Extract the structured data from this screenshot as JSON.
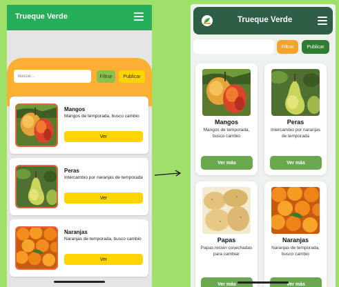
{
  "left_app": {
    "title": "Trueque Verde",
    "search_placeholder": "Buscar...",
    "filter_label": "Filtrar",
    "publish_label": "Publicar",
    "items": [
      {
        "name": "Mangos",
        "description": "Mangos de temporada, busco cambio",
        "button": "Ver",
        "image": "mango-photo"
      },
      {
        "name": "Peras",
        "description": "Intercambio por naranjas de temporada",
        "button": "Ver",
        "image": "pear-photo"
      },
      {
        "name": "Naranjas",
        "description": "Naranjas de temporada, busco cambio",
        "button": "Ver",
        "image": "orange-photo"
      }
    ]
  },
  "right_app": {
    "title": "Trueque Verde",
    "search_placeholder": "",
    "filter_label": "Filtrar",
    "publish_label": "Publicar",
    "items": [
      {
        "name": "Mangos",
        "description": "Mangos de temporada, busco cambio",
        "button": "Ver más",
        "image": "mango-photo"
      },
      {
        "name": "Peras",
        "description": "Intercambio por naranjas de temporada",
        "button": "Ver más",
        "image": "pear-photo"
      },
      {
        "name": "Papas",
        "description": "Papas recién cosechadas para cambiar",
        "button": "Ver más",
        "image": "potato-photo"
      },
      {
        "name": "Naranjas",
        "description": "Naranjas de temporada, busco cambio",
        "button": "Ver más",
        "image": "orange-photo"
      }
    ]
  },
  "colors": {
    "background": "#9ee06a",
    "left_header": "#27ae5a",
    "left_orange_panel": "#fbb034",
    "left_button_yellow": "#ffd400",
    "left_filter_green": "#8bc34a",
    "right_header": "#2e5e45",
    "right_filter_orange": "#f7a32b",
    "right_publish_green": "#2e7d32",
    "right_vermas_green": "#6aa84f"
  },
  "icons": [
    "hamburger-menu-icon",
    "leaf-logo-icon",
    "arrow-right-icon"
  ]
}
